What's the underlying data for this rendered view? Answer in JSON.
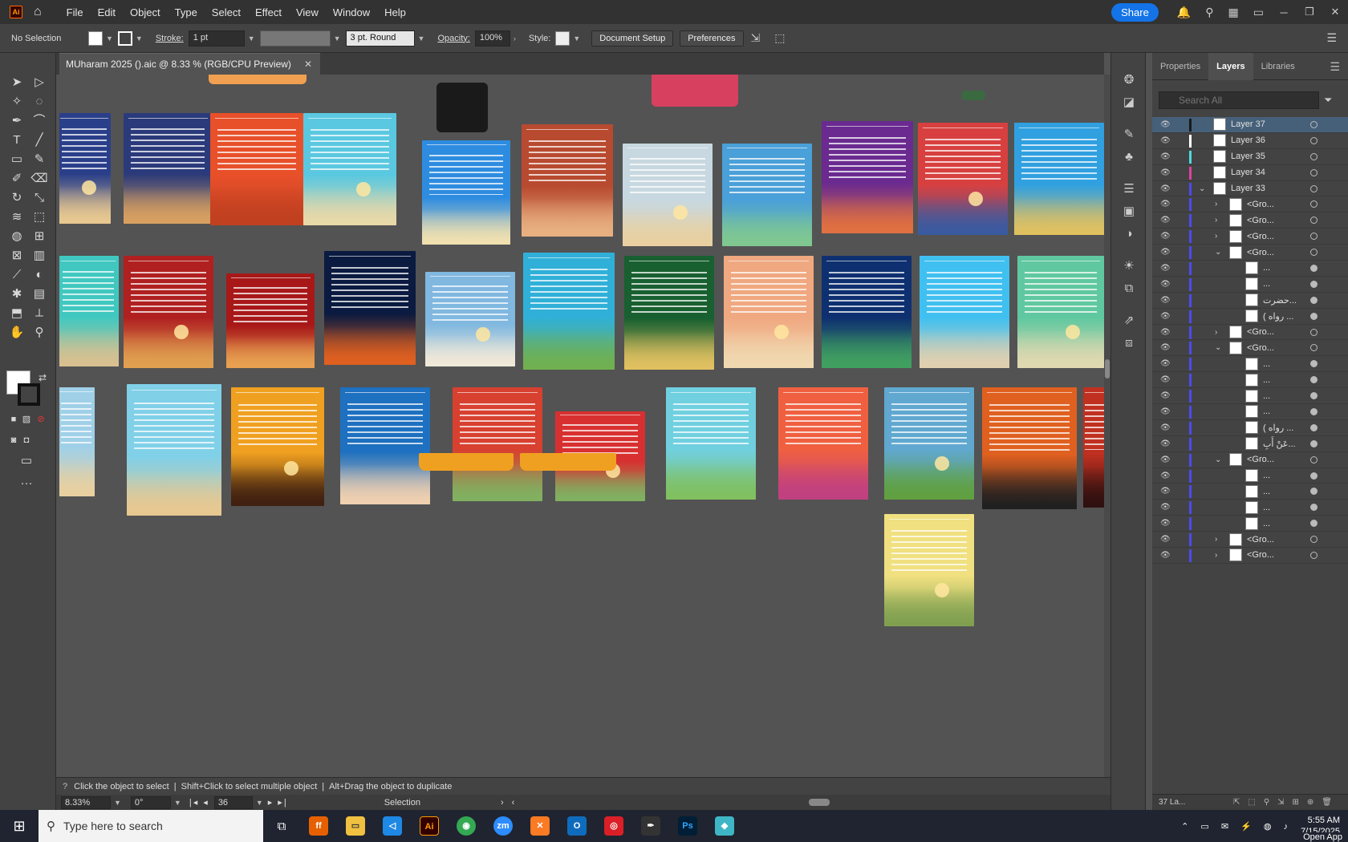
{
  "app": {
    "logo": "Ai",
    "menus": [
      "File",
      "Edit",
      "Object",
      "Type",
      "Select",
      "Effect",
      "View",
      "Window",
      "Help"
    ],
    "share_label": "Share"
  },
  "control": {
    "selection": "No Selection",
    "stroke_label": "Stroke:",
    "stroke_value": "1 pt",
    "brush_value": "3 pt. Round",
    "opacity_label": "Opacity:",
    "opacity_value": "100%",
    "style_label": "Style:",
    "doc_setup": "Document Setup",
    "preferences": "Preferences"
  },
  "document": {
    "tab_title": "MUharam 2025 ().aic @ 8.33 % (RGB/CPU Preview)"
  },
  "panel": {
    "tabs": [
      "Properties",
      "Layers",
      "Libraries"
    ],
    "active_tab": "Layers",
    "search_placeholder": "Search All",
    "layers": [
      {
        "name": "Layer 37",
        "color": "#1a1a1a",
        "indent": 0,
        "twirl": "",
        "selected": true
      },
      {
        "name": "Layer 36",
        "color": "#ffffff",
        "indent": 0,
        "twirl": ""
      },
      {
        "name": "Layer 35",
        "color": "#4fd8e0",
        "indent": 0,
        "twirl": ""
      },
      {
        "name": "Layer 34",
        "color": "#e040a0",
        "indent": 0,
        "twirl": ""
      },
      {
        "name": "Layer 33",
        "color": "#4a4af0",
        "indent": 0,
        "twirl": "open"
      },
      {
        "name": "<Gro...",
        "color": "#4a4af0",
        "indent": 1,
        "twirl": "closed"
      },
      {
        "name": "<Gro...",
        "color": "#4a4af0",
        "indent": 1,
        "twirl": "closed"
      },
      {
        "name": "<Gro...",
        "color": "#4a4af0",
        "indent": 1,
        "twirl": "closed"
      },
      {
        "name": "<Gro...",
        "color": "#4a4af0",
        "indent": 1,
        "twirl": "open"
      },
      {
        "name": "<Gro...",
        "color": "#4a4af0",
        "indent": 1,
        "twirl": "closed"
      },
      {
        "name": "<Gro...",
        "color": "#4a4af0",
        "indent": 1,
        "twirl": "open"
      },
      {
        "name": "<Gro...",
        "color": "#4a4af0",
        "indent": 1,
        "twirl": "open"
      },
      {
        "name": "<Gro...",
        "color": "#4a4af0",
        "indent": 1,
        "twirl": "closed"
      },
      {
        "name": "<Gro...",
        "color": "#4a4af0",
        "indent": 1,
        "twirl": "closed"
      }
    ],
    "sublayers": [
      {
        "name": "...",
        "indent": 2
      },
      {
        "name": "...",
        "indent": 2
      },
      {
        "name": "حضرت...",
        "indent": 2
      },
      {
        "name": "( رواه ...",
        "indent": 2
      },
      {
        "name": "...",
        "indent": 2
      },
      {
        "name": "...",
        "indent": 2
      },
      {
        "name": "...",
        "indent": 2
      },
      {
        "name": "...",
        "indent": 2
      },
      {
        "name": "( رواه ...",
        "indent": 2
      },
      {
        "name": "عَنْ أَبِ...",
        "indent": 2
      }
    ],
    "footer_count": "37 La..."
  },
  "status": {
    "hint_click": "Click the object to select",
    "hint_shift": "Shift+Click to select multiple object",
    "hint_alt": "Alt+Drag the object to duplicate",
    "zoom": "8.33%",
    "rotation": "0°",
    "artboard": "36",
    "tool": "Selection"
  },
  "taskbar": {
    "search_placeholder": "Type here to search",
    "time": "5:55 AM",
    "date": "7/15/2025",
    "open_app": "Open App"
  }
}
